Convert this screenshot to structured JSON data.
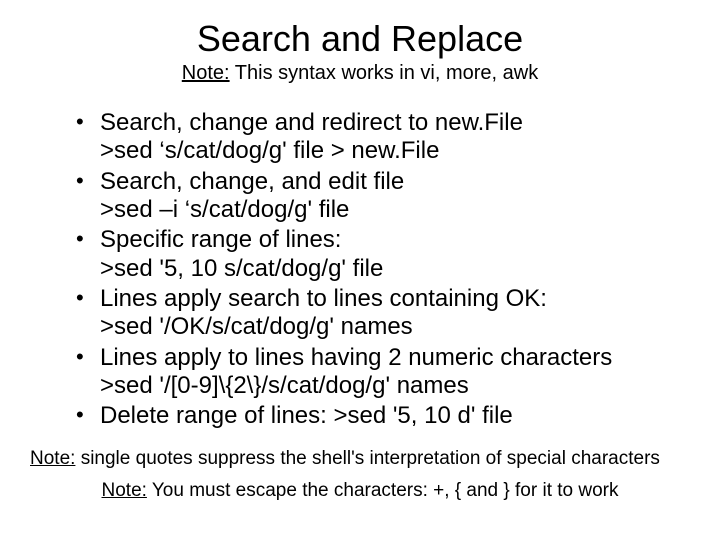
{
  "title": "Search and Replace",
  "subtitle": {
    "label": "Note:",
    "text": " This syntax works in vi, more, awk"
  },
  "items": [
    {
      "desc": "Search, change and redirect to new.File",
      "cmd": ">sed ‘s/cat/dog/g' file > new.File"
    },
    {
      "desc": "Search, change, and edit file",
      "cmd": ">sed –i ‘s/cat/dog/g' file"
    },
    {
      "desc": "Specific range of lines:",
      "cmd": ">sed '5, 10 s/cat/dog/g' file"
    },
    {
      "desc": "Lines apply search to lines containing OK:",
      "cmd": ">sed '/OK/s/cat/dog/g' names"
    },
    {
      "desc": "Lines apply to lines having 2 numeric characters",
      "cmd": ">sed '/[0-9]\\{2\\}/s/cat/dog/g' names"
    },
    {
      "desc": "Delete range of lines: >sed '5, 10 d' file",
      "cmd": ""
    }
  ],
  "note1": {
    "label": "Note:",
    "text": " single quotes suppress the shell's interpretation of special characters"
  },
  "note2": {
    "label": "Note:",
    "text": " You must escape the characters: +, { and } for it to work"
  }
}
